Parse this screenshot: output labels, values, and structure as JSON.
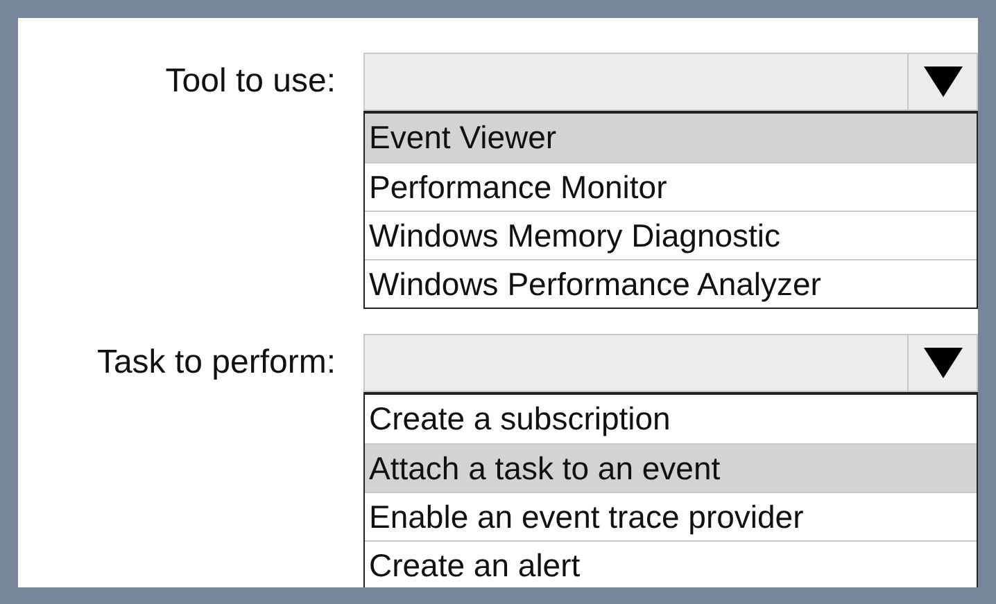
{
  "fields": [
    {
      "label": "Tool to use:",
      "options": [
        {
          "label": "Event Viewer",
          "selected": true
        },
        {
          "label": "Performance Monitor",
          "selected": false
        },
        {
          "label": "Windows Memory Diagnostic",
          "selected": false
        },
        {
          "label": "Windows Performance Analyzer",
          "selected": false
        }
      ]
    },
    {
      "label": "Task to perform:",
      "options": [
        {
          "label": "Create a subscription",
          "selected": false
        },
        {
          "label": "Attach a task to an event",
          "selected": true
        },
        {
          "label": "Enable an event trace provider",
          "selected": false
        },
        {
          "label": "Create an alert",
          "selected": false
        }
      ]
    }
  ]
}
